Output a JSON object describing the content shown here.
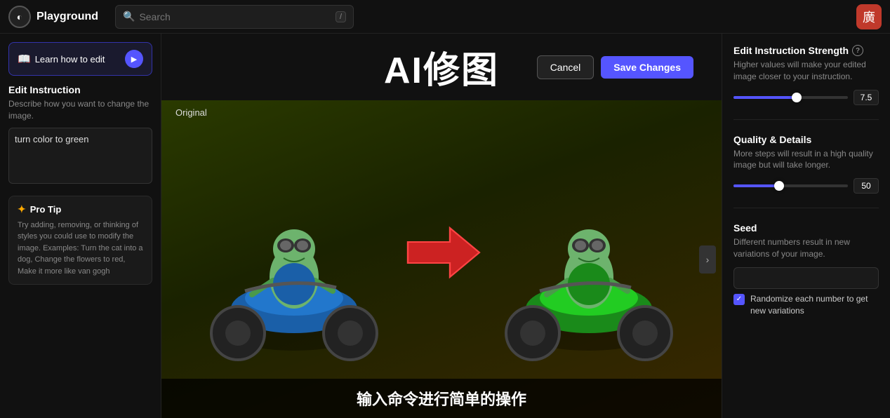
{
  "topnav": {
    "logo_label": "Playground",
    "logo_icon": "◐",
    "search_placeholder": "Search",
    "search_shortcut": "/",
    "avatar_emoji": "廣"
  },
  "left_sidebar": {
    "learn_btn_label": "Learn how to edit",
    "learn_icon": "▷",
    "edit_instruction": {
      "title": "Edit Instruction",
      "description": "Describe how you want to change the image.",
      "textarea_value": "turn color to green"
    },
    "pro_tip": {
      "title": "Pro Tip",
      "icon": "✦",
      "text": "Try adding, removing, or thinking of styles you could use to modify the image. Examples: Turn the cat into a dog, Change the flowers to red, Make it more like van gogh"
    }
  },
  "center": {
    "title": "AI修图",
    "cancel_label": "Cancel",
    "save_label": "Save Changes",
    "original_label": "Original",
    "overlay_text": "输入命令进行简单的操作"
  },
  "right_sidebar": {
    "edit_strength": {
      "title": "Edit Instruction Strength",
      "description": "Higher values will make your edited image closer to your instruction.",
      "value": "7.5",
      "fill_percent": 55
    },
    "quality": {
      "title": "Quality & Details",
      "description": "More steps will result in a high quality image but will take longer.",
      "value": "50",
      "fill_percent": 40
    },
    "seed": {
      "title": "Seed",
      "description": "Different numbers result in new variations of your image.",
      "placeholder": ""
    },
    "randomize": {
      "label": "Randomize each number to get new variations",
      "checked": true
    }
  }
}
